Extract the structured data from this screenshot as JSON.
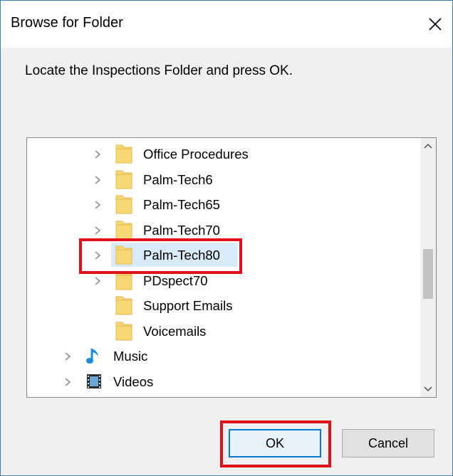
{
  "dialog": {
    "title": "Browse for Folder",
    "close_label": "×",
    "instructions": "Locate the Inspections Folder and press OK."
  },
  "tree": {
    "items": [
      {
        "label": "Office Procedures",
        "level": 2,
        "expandable": true,
        "type": "folder"
      },
      {
        "label": "Palm-Tech6",
        "level": 2,
        "expandable": true,
        "type": "folder"
      },
      {
        "label": "Palm-Tech65",
        "level": 2,
        "expandable": true,
        "type": "folder"
      },
      {
        "label": "Palm-Tech70",
        "level": 2,
        "expandable": true,
        "type": "folder"
      },
      {
        "label": "Palm-Tech80",
        "level": 2,
        "expandable": true,
        "type": "folder",
        "selected": true
      },
      {
        "label": "PDspect70",
        "level": 2,
        "expandable": true,
        "type": "folder"
      },
      {
        "label": "Support Emails",
        "level": 2,
        "expandable": false,
        "type": "folder"
      },
      {
        "label": "Voicemails",
        "level": 2,
        "expandable": false,
        "type": "folder"
      },
      {
        "label": "Music",
        "level": 1,
        "expandable": true,
        "type": "music"
      },
      {
        "label": "Videos",
        "level": 1,
        "expandable": true,
        "type": "video"
      }
    ]
  },
  "buttons": {
    "ok_label": "OK",
    "cancel_label": "Cancel"
  },
  "colors": {
    "highlight_box": "#e0101a",
    "folder_fill": "#f8d775",
    "selection": "#d9ebf9",
    "accent": "#0078d7"
  }
}
